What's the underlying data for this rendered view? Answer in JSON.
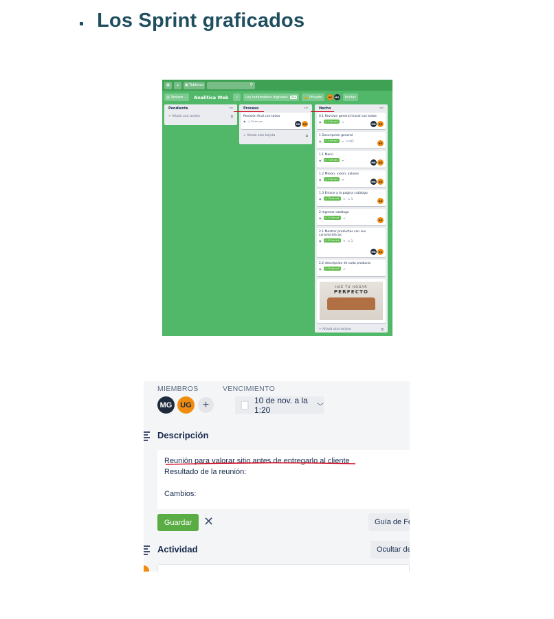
{
  "page": {
    "heading": "Los Sprint graficados"
  },
  "board": {
    "topbar": {
      "grid_icon": "grid-icon",
      "home_icon": "home-icon",
      "boards_label": "Tableros",
      "search_icon": "search-icon"
    },
    "boardbar": {
      "view_label": "Tablero",
      "title": "Analítica Web",
      "team_label": "Los indomables digitales",
      "team_badge": "Free",
      "privacy_label": "Privado",
      "invite_label": "Invitar",
      "members": [
        "UG",
        "MG"
      ]
    },
    "lists": [
      {
        "title": "Pendiente",
        "footer": "Añada una tarjeta",
        "cards": []
      },
      {
        "title": "Proceso",
        "footer": "Añada otra tarjeta",
        "cards": [
          {
            "title": "Revisión final con todos",
            "due": "10 de nov.",
            "members": [
              "MG",
              "UG"
            ]
          }
        ]
      },
      {
        "title": "Hecho",
        "footer": "Añada otra tarjeta",
        "cards": [
          {
            "title": "0.1 Revision general inicial con todos",
            "due": "2 de oct.",
            "members": [
              "MG",
              "UG"
            ]
          },
          {
            "title": "1 Descripción general",
            "due": "5 de oct.",
            "checklist": "0/2",
            "members": [
              "UG"
            ]
          },
          {
            "title": "1.1 Menú",
            "due": "7 de oct.",
            "members": [
              "MG",
              "UG"
            ]
          },
          {
            "title": "1.2 Mision, vision, valores",
            "due": "9 de oct.",
            "members": [
              "MG",
              "UG"
            ]
          },
          {
            "title": "1.3 Enlace a la pagina catálogo",
            "due": "19 de oct.",
            "comments": "1",
            "members": [
              "UG"
            ]
          },
          {
            "title": "2 Ingresar catálogo",
            "due": "21 de oct.",
            "members": [
              "UG"
            ]
          },
          {
            "title": "2.1 Mostrar productos con sus características",
            "due": "22 de oct.",
            "comments": "1",
            "members": [
              "MG",
              "UG"
            ]
          },
          {
            "title": "2.2 descripcion de cada producto",
            "due": "29 de oct.",
            "members": [
              "UG"
            ]
          }
        ],
        "poster": {
          "line1": "HAZ TU HOGAR",
          "line2": "PERFECTO"
        }
      }
    ]
  },
  "detail": {
    "members_label": "MIEMBROS",
    "due_label": "VENCIMIENTO",
    "members": [
      "MG",
      "UG"
    ],
    "add_member": "+",
    "due_value": "10 de nov. a la 1:20",
    "description_title": "Descripción",
    "description_lines": [
      "Reunión para valorar sitio antes de entregarlo al cliente",
      "Resultado de la reunión:",
      "",
      "Cambios:"
    ],
    "save_label": "Guardar",
    "close_symbol": "✕",
    "format_guide_label": "Guía de Fo",
    "activity_title": "Actividad",
    "hide_details_label": "Ocultar de"
  },
  "colors": {
    "board_bg": "#51b86a",
    "heading": "#1f4e5f",
    "due_green": "#61bd4f",
    "save_green": "#5aac44",
    "annotation_red": "#d0021b",
    "ug_orange": "#f08c10",
    "mg_navy": "#1e2b3c"
  }
}
